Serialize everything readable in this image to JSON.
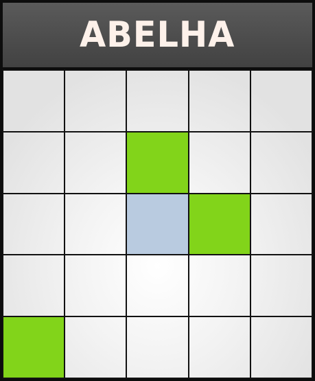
{
  "title": "ABELHA",
  "board": {
    "rows": 5,
    "cols": 5,
    "colors": {
      "empty": "transparent",
      "green": "#82d41a",
      "blue": "#b9cbe0",
      "grid_line": "#111111",
      "title_bg": "#474747",
      "title_text": "#fdf1ea"
    },
    "cells": [
      [
        "empty",
        "empty",
        "empty",
        "empty",
        "empty"
      ],
      [
        "empty",
        "empty",
        "green",
        "empty",
        "empty"
      ],
      [
        "empty",
        "empty",
        "blue",
        "green",
        "empty"
      ],
      [
        "empty",
        "empty",
        "empty",
        "empty",
        "empty"
      ],
      [
        "green",
        "empty",
        "empty",
        "empty",
        "empty"
      ]
    ]
  }
}
